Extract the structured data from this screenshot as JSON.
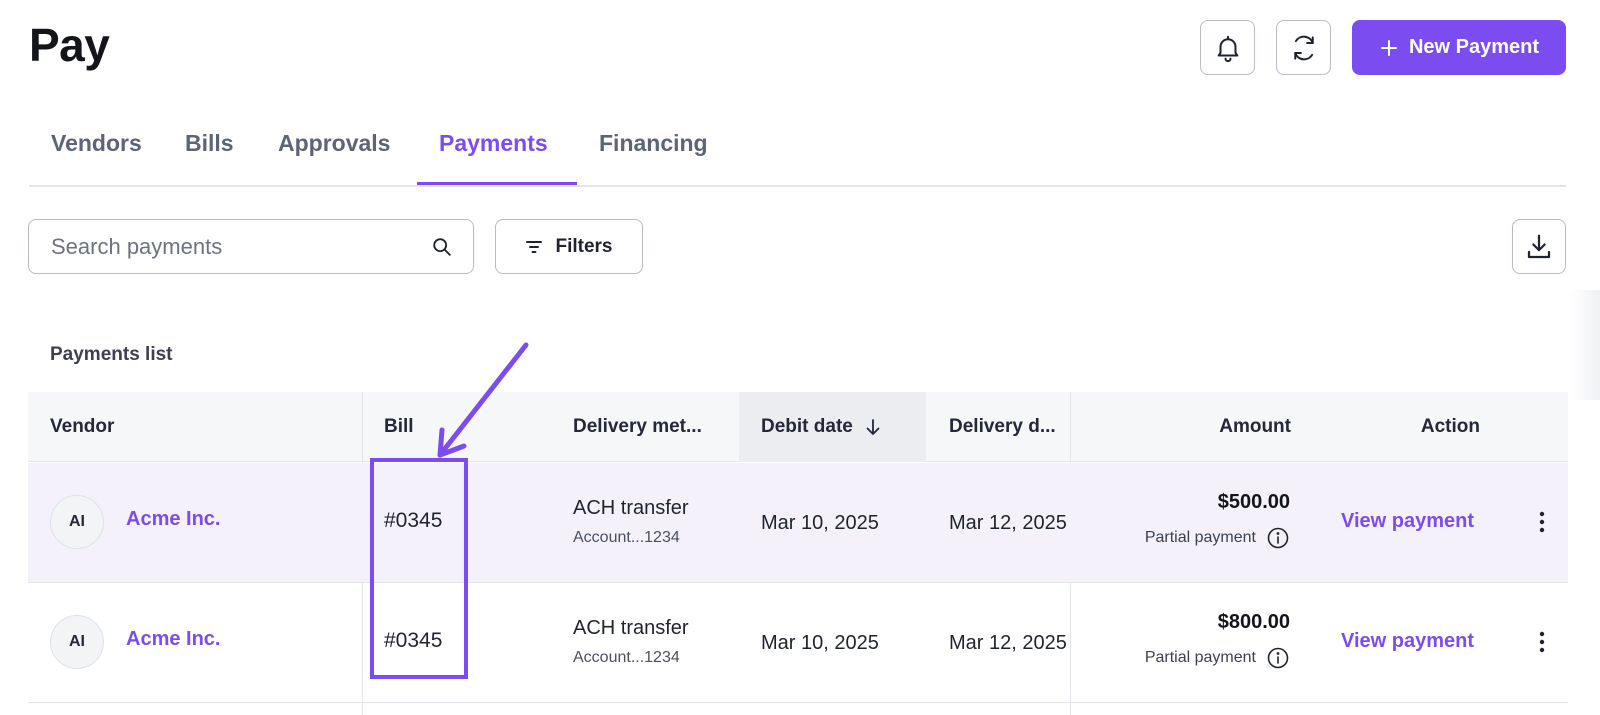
{
  "page": {
    "title": "Pay"
  },
  "header": {
    "new_payment_label": "New Payment"
  },
  "tabs": [
    {
      "label": "Vendors",
      "active": false
    },
    {
      "label": "Bills",
      "active": false
    },
    {
      "label": "Approvals",
      "active": false
    },
    {
      "label": "Payments",
      "active": true
    },
    {
      "label": "Financing",
      "active": false
    }
  ],
  "toolbar": {
    "search_placeholder": "Search payments",
    "filters_label": "Filters"
  },
  "list_title": "Payments list",
  "table": {
    "columns": [
      "Vendor",
      "Bill",
      "Delivery met...",
      "Debit date",
      "Delivery d...",
      "Amount",
      "Action"
    ],
    "sorted_column": "Debit date",
    "sort_direction": "descending",
    "rows": [
      {
        "avatar": "AI",
        "vendor": "Acme Inc.",
        "bill": "#0345",
        "method": "ACH transfer",
        "method_account": "Account...1234",
        "debit_date": "Mar 10, 2025",
        "delivery_date": "Mar 12, 2025",
        "amount": "$500.00",
        "amount_note": "Partial payment",
        "action": "View payment",
        "highlighted": true
      },
      {
        "avatar": "AI",
        "vendor": "Acme Inc.",
        "bill": "#0345",
        "method": "ACH transfer",
        "method_account": "Account...1234",
        "debit_date": "Mar 10, 2025",
        "delivery_date": "Mar 12, 2025",
        "amount": "$800.00",
        "amount_note": "Partial payment",
        "action": "View payment",
        "highlighted": false
      }
    ]
  },
  "icons": {
    "notifications": "bell-icon",
    "refresh": "refresh-icon",
    "new_payment": "plus-icon",
    "search": "search-icon",
    "filters": "filter-icon",
    "download": "download-icon",
    "sort": "arrow-down-icon",
    "info": "info-icon",
    "more": "kebab-icon"
  },
  "colors": {
    "accent": "#7b4cf0",
    "row_highlight": "#f4f1fb",
    "header_bg": "#f6f7f9",
    "border": "#b8bcc6"
  }
}
